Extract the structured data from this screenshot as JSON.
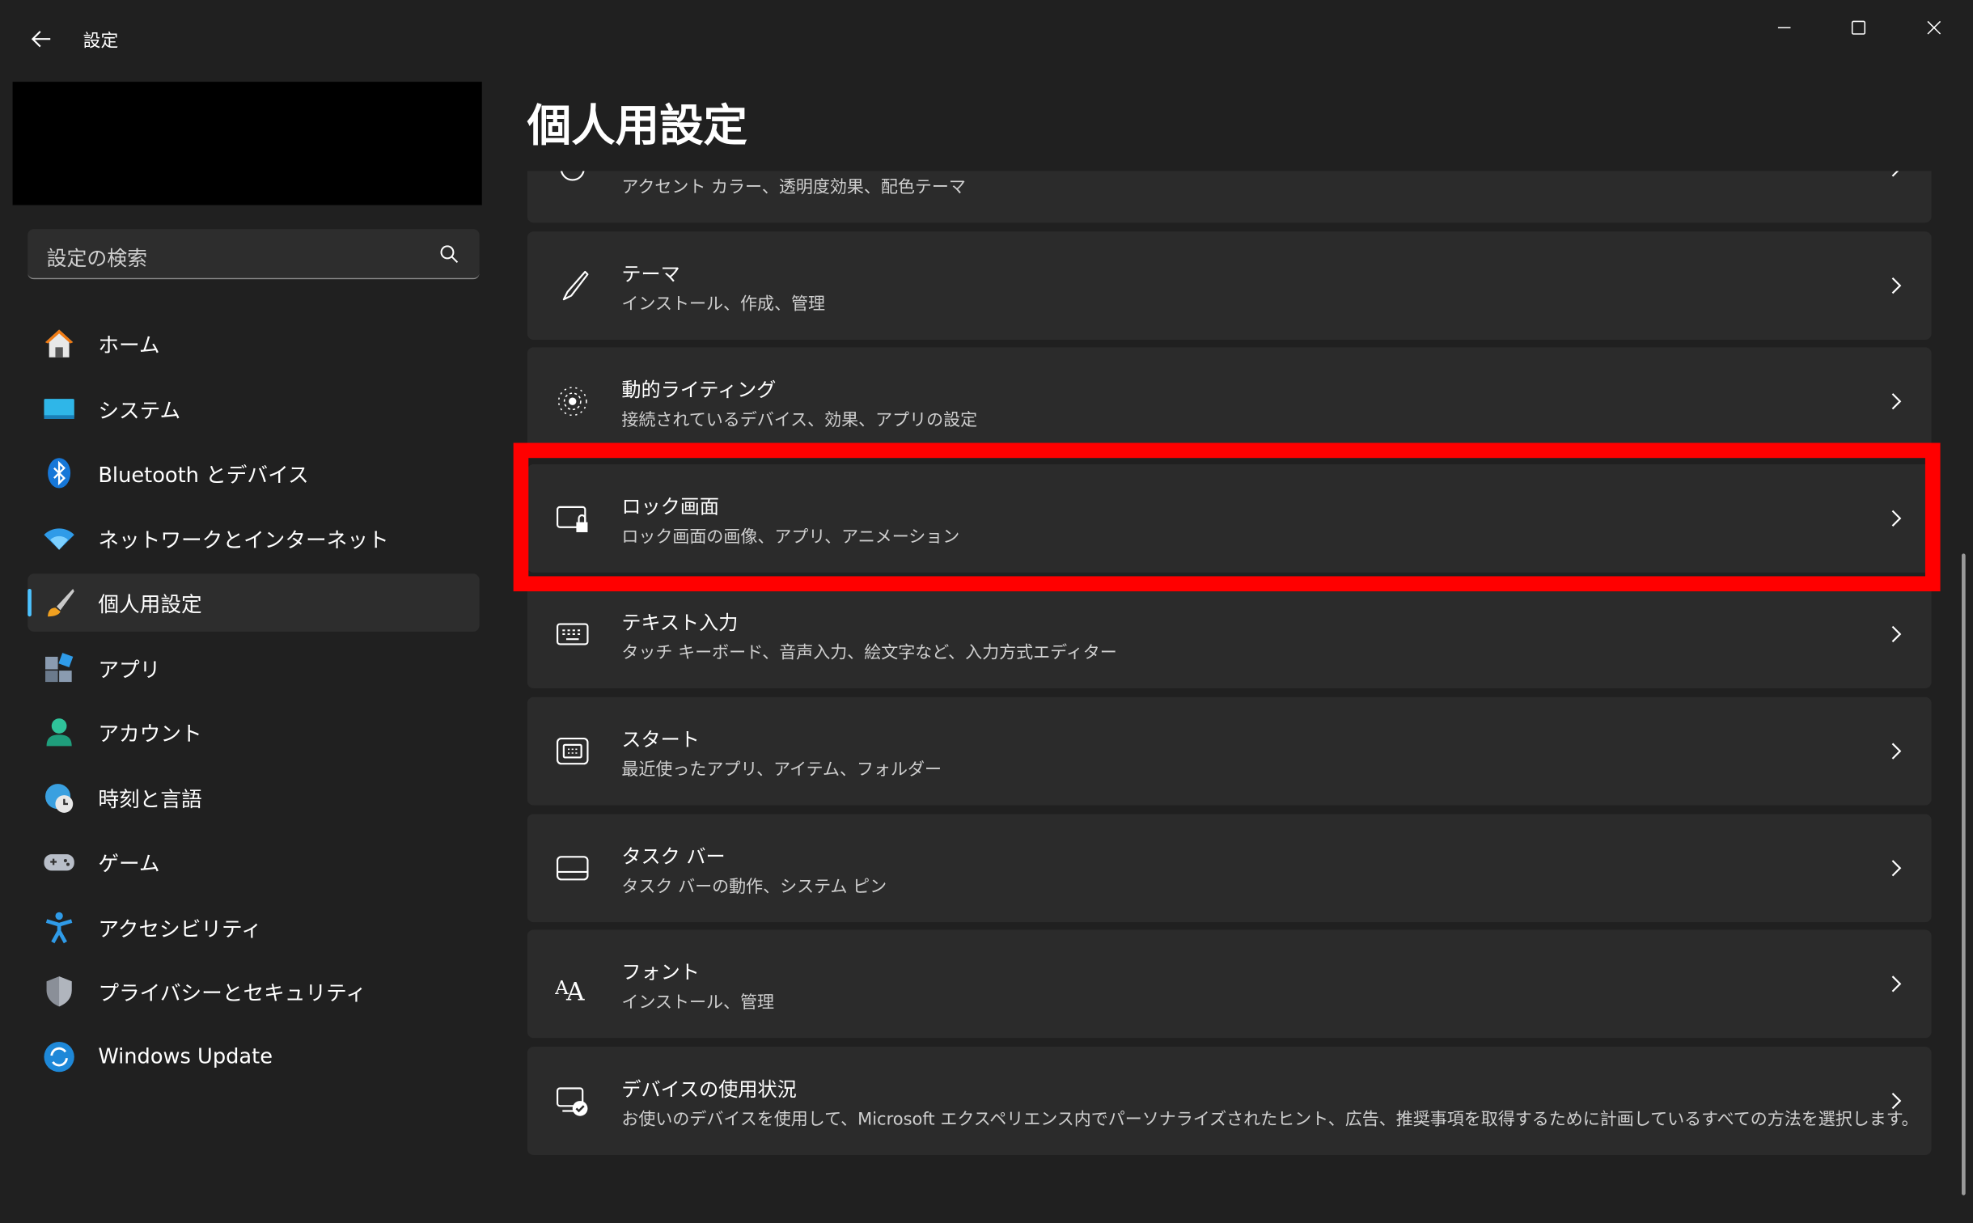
{
  "window": {
    "title": "設定"
  },
  "search": {
    "placeholder": "設定の検索"
  },
  "sidebar": {
    "items": [
      {
        "label": "ホーム",
        "icon": "home-icon"
      },
      {
        "label": "システム",
        "icon": "system-icon"
      },
      {
        "label": "Bluetooth とデバイス",
        "icon": "bluetooth-icon"
      },
      {
        "label": "ネットワークとインターネット",
        "icon": "wifi-icon"
      },
      {
        "label": "個人用設定",
        "icon": "brush-icon",
        "selected": true
      },
      {
        "label": "アプリ",
        "icon": "apps-icon"
      },
      {
        "label": "アカウント",
        "icon": "account-icon"
      },
      {
        "label": "時刻と言語",
        "icon": "globe-clock-icon"
      },
      {
        "label": "ゲーム",
        "icon": "gamepad-icon"
      },
      {
        "label": "アクセシビリティ",
        "icon": "accessibility-icon"
      },
      {
        "label": "プライバシーとセキュリティ",
        "icon": "shield-icon"
      },
      {
        "label": "Windows Update",
        "icon": "update-icon"
      }
    ]
  },
  "main": {
    "title": "個人用設定",
    "cards": [
      {
        "title": "",
        "subtitle": "アクセント カラー、透明度効果、配色テーマ",
        "icon": "palette-icon"
      },
      {
        "title": "テーマ",
        "subtitle": "インストール、作成、管理",
        "icon": "brush-icon"
      },
      {
        "title": "動的ライティング",
        "subtitle": "接続されているデバイス、効果、アプリの設定",
        "icon": "lighting-icon"
      },
      {
        "title": "ロック画面",
        "subtitle": "ロック画面の画像、アプリ、アニメーション",
        "icon": "lock-screen-icon"
      },
      {
        "title": "テキスト入力",
        "subtitle": "タッチ キーボード、音声入力、絵文字など、入力方式エディター",
        "icon": "keyboard-icon"
      },
      {
        "title": "スタート",
        "subtitle": "最近使ったアプリ、アイテム、フォルダー",
        "icon": "start-icon"
      },
      {
        "title": "タスク バー",
        "subtitle": "タスク バーの動作、システム ピン",
        "icon": "taskbar-icon"
      },
      {
        "title": "フォント",
        "subtitle": "インストール、管理",
        "icon": "font-icon"
      },
      {
        "title": "デバイスの使用状況",
        "subtitle": "お使いのデバイスを使用して、Microsoft エクスペリエンス内でパーソナライズされたヒント、広告、推奨事項を取得するために計画しているすべての方法を選択します。",
        "icon": "device-usage-icon"
      }
    ]
  },
  "colors": {
    "background": "#202020",
    "card": "#2b2b2b",
    "accent": "#4cc2ff",
    "highlight": "#ff0000"
  }
}
